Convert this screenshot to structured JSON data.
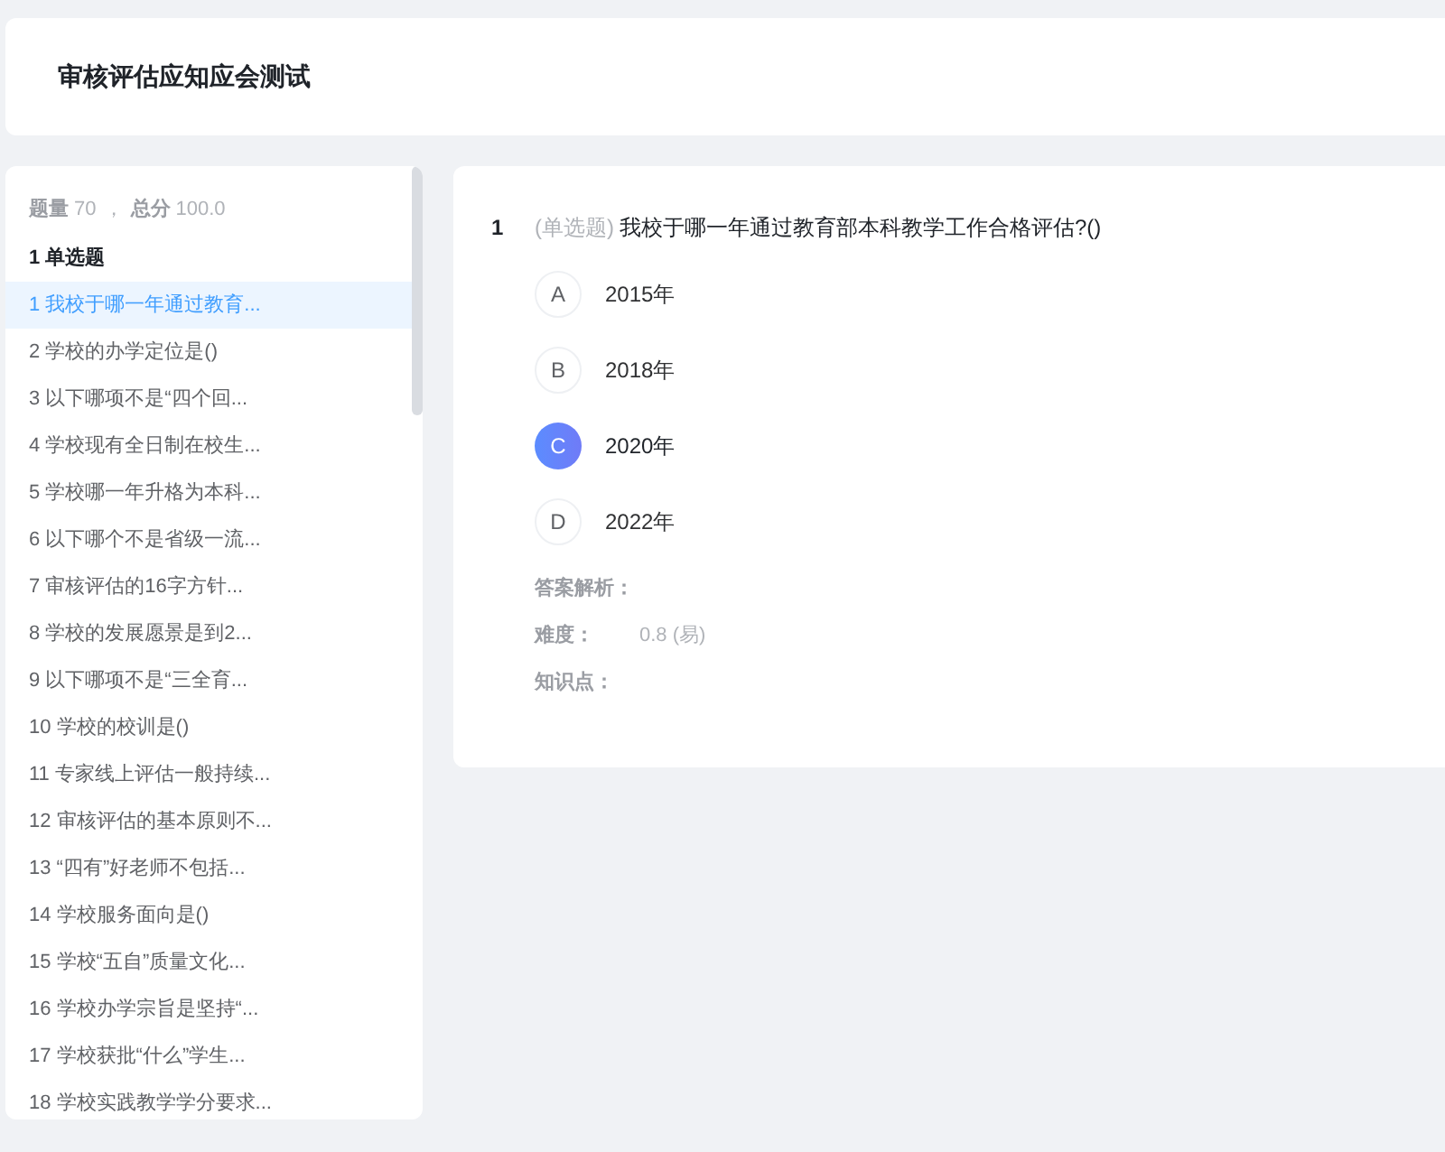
{
  "header": {
    "title": "审核评估应知应会测试"
  },
  "sidebar": {
    "summary": [
      {
        "label": "题量",
        "value": "70"
      },
      {
        "label": "总分",
        "value": "100.0"
      }
    ],
    "separator": "，",
    "section": "1 单选题",
    "items": [
      {
        "label": "1 我校于哪一年通过教育...",
        "selected": true
      },
      {
        "label": "2 学校的办学定位是()",
        "selected": false
      },
      {
        "label": "3 以下哪项不是“四个回...",
        "selected": false
      },
      {
        "label": "4 学校现有全日制在校生...",
        "selected": false
      },
      {
        "label": "5 学校哪一年升格为本科...",
        "selected": false
      },
      {
        "label": "6 以下哪个不是省级一流...",
        "selected": false
      },
      {
        "label": "7 审核评估的16字方针...",
        "selected": false
      },
      {
        "label": "8 学校的发展愿景是到2...",
        "selected": false
      },
      {
        "label": "9 以下哪项不是“三全育...",
        "selected": false
      },
      {
        "label": "10 学校的校训是()",
        "selected": false
      },
      {
        "label": "11 专家线上评估一般持续...",
        "selected": false
      },
      {
        "label": "12 审核评估的基本原则不...",
        "selected": false
      },
      {
        "label": "13 “四有”好老师不包括...",
        "selected": false
      },
      {
        "label": "14 学校服务面向是()",
        "selected": false
      },
      {
        "label": "15 学校“五自”质量文化...",
        "selected": false
      },
      {
        "label": "16 学校办学宗旨是坚持“...",
        "selected": false
      },
      {
        "label": "17 学校获批“什么”学生...",
        "selected": false
      },
      {
        "label": "18 学校实践教学学分要求...",
        "selected": false
      }
    ]
  },
  "question": {
    "number": "1",
    "type": "(单选题)",
    "text": "我校于哪一年通过教育部本科教学工作合格评估?()",
    "options": [
      {
        "letter": "A",
        "text": "2015年",
        "selected": false
      },
      {
        "letter": "B",
        "text": "2018年",
        "selected": false
      },
      {
        "letter": "C",
        "text": "2020年",
        "selected": true
      },
      {
        "letter": "D",
        "text": "2022年",
        "selected": false
      }
    ],
    "details": [
      {
        "label": "答案解析："
      },
      {
        "label": "难度：",
        "value": "0.8 (易)"
      },
      {
        "label": "知识点："
      }
    ]
  }
}
